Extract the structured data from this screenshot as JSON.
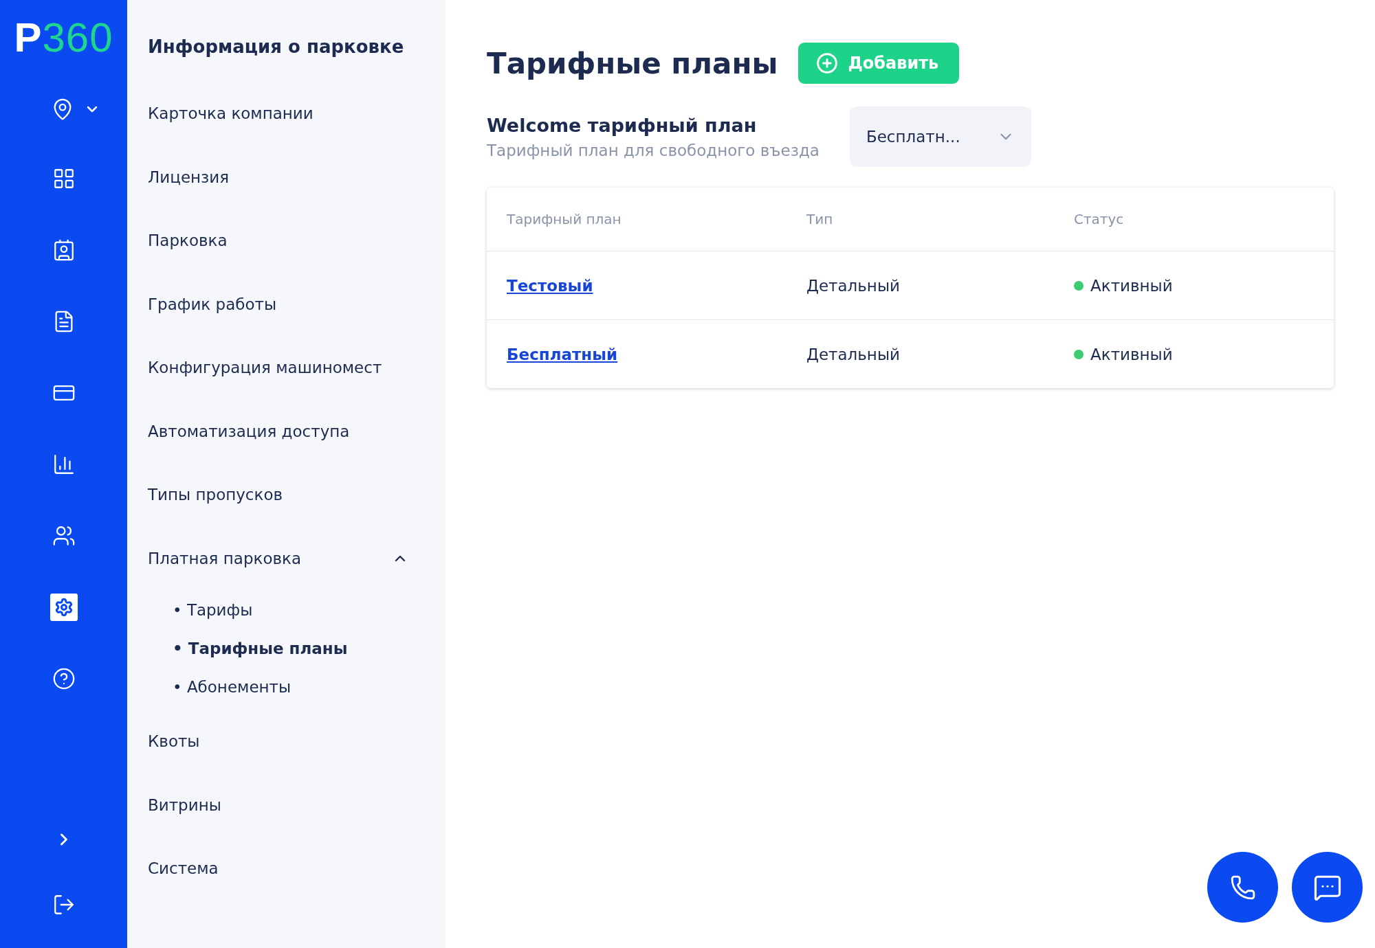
{
  "logo": {
    "letter": "P",
    "number": "360"
  },
  "rail_items": [
    {
      "selected": false
    },
    {
      "selected": false
    },
    {
      "selected": false
    },
    {
      "selected": false
    },
    {
      "selected": false
    },
    {
      "selected": false
    },
    {
      "selected": false
    },
    {
      "selected": true
    },
    {
      "selected": false
    }
  ],
  "sidebar": {
    "title": "Информация о парковке",
    "items": [
      {
        "label": "Карточка компании"
      },
      {
        "label": "Лицензия"
      },
      {
        "label": "Парковка"
      },
      {
        "label": "График работы"
      },
      {
        "label": "Конфигурация машиномест"
      },
      {
        "label": "Автоматизация доступа"
      },
      {
        "label": "Типы пропусков"
      },
      {
        "label": "Платная парковка",
        "expanded": true,
        "children": [
          {
            "label": "• Тарифы",
            "selected": false
          },
          {
            "label": "• Тарифные планы",
            "selected": true
          },
          {
            "label": "• Абонементы",
            "selected": false
          }
        ]
      },
      {
        "label": "Квоты"
      },
      {
        "label": "Витрины"
      },
      {
        "label": "Система"
      }
    ]
  },
  "page": {
    "title": "Тарифные планы",
    "add_button": "Добавить",
    "welcome": {
      "title": "Welcome тарифный план",
      "description": "Тарифный план для свободного въезда",
      "select_value": "Бесплатн..."
    }
  },
  "table": {
    "columns": [
      "Тарифный план",
      "Тип",
      "Статус"
    ],
    "rows": [
      {
        "plan": "Тестовый",
        "type": "Детальный",
        "status": "Активный",
        "color": "#3ccb6e"
      },
      {
        "plan": "Бесплатный",
        "type": "Детальный",
        "status": "Активный",
        "color": "#3ccb6e"
      }
    ]
  }
}
